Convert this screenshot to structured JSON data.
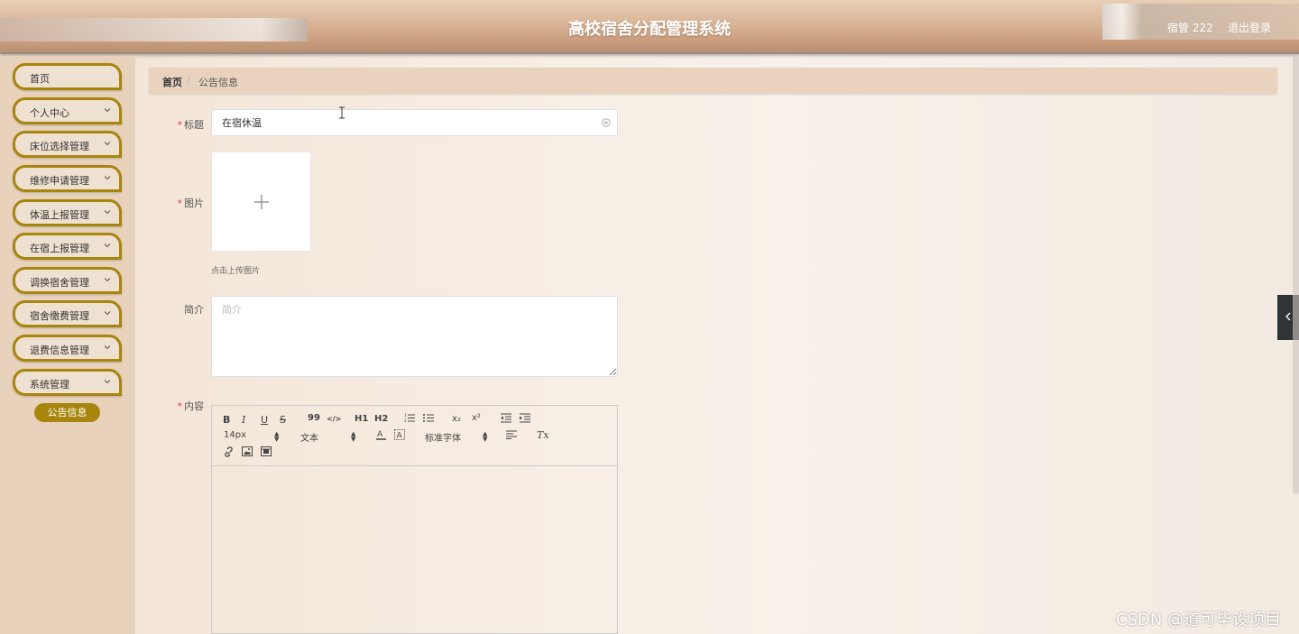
{
  "header": {
    "title": "高校宿舍分配管理系统",
    "user_label": "宿管 222",
    "logout_label": "退出登录"
  },
  "sidebar": {
    "items": [
      {
        "label": "首页",
        "has_arrow": false
      },
      {
        "label": "个人中心",
        "has_arrow": true
      },
      {
        "label": "床位选择管理",
        "has_arrow": true
      },
      {
        "label": "维修申请管理",
        "has_arrow": true
      },
      {
        "label": "体温上报管理",
        "has_arrow": true
      },
      {
        "label": "在宿上报管理",
        "has_arrow": true
      },
      {
        "label": "调换宿舍管理",
        "has_arrow": true
      },
      {
        "label": "宿舍缴费管理",
        "has_arrow": true
      },
      {
        "label": "退费信息管理",
        "has_arrow": true
      },
      {
        "label": "系统管理",
        "has_arrow": true
      }
    ],
    "active_submenu": "公告信息"
  },
  "breadcrumb": {
    "home": "首页",
    "separator": "/",
    "current": "公告信息"
  },
  "form": {
    "title_label": "标题",
    "title_value": "在宿休温",
    "image_label": "图片",
    "upload_tip": "点击上传图片",
    "intro_label": "简介",
    "intro_placeholder": "简介",
    "content_label": "内容",
    "required_mark": "*"
  },
  "editor": {
    "font_size": "14px",
    "block_format": "文本",
    "font_family": "标准字体",
    "buttons": {
      "bold": "B",
      "italic": "I",
      "underline": "U",
      "strike": "S",
      "quote": "99",
      "code": "</>",
      "h1": "H1",
      "h2": "H2",
      "sub": "x₂",
      "sup": "x²",
      "clean": "Tx"
    }
  },
  "watermark": "CSDN @道可毕设项目"
}
